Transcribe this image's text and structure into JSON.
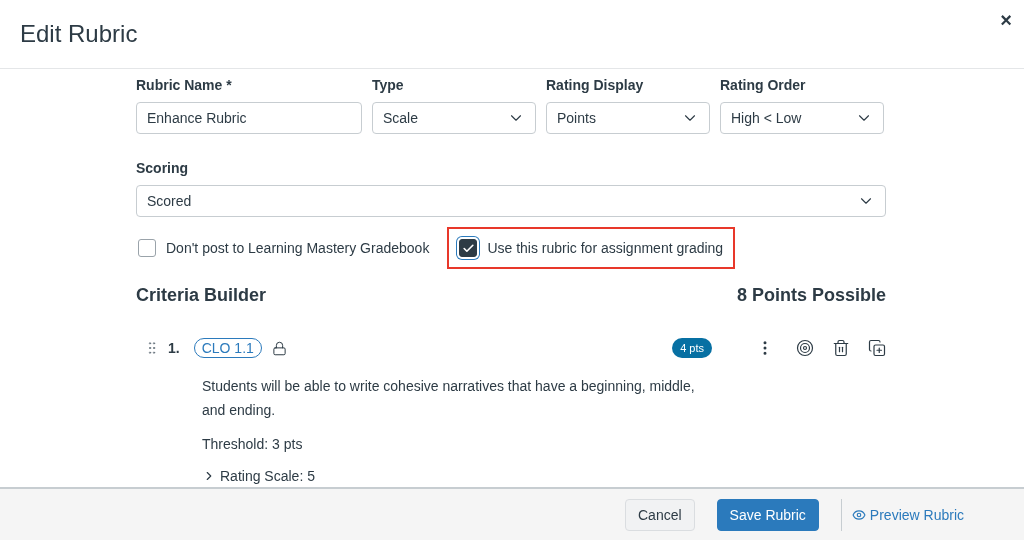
{
  "dialog": {
    "title": "Edit Rubric",
    "close": "×"
  },
  "fields": [
    {
      "kind": "text",
      "label": "Rubric Name *",
      "value": "Enhance Rubric"
    },
    {
      "kind": "select",
      "label": "Type",
      "value": "Scale"
    },
    {
      "kind": "select",
      "label": "Rating Display",
      "value": "Points"
    },
    {
      "kind": "select",
      "label": "Rating Order",
      "value": "High < Low"
    }
  ],
  "scoring": {
    "label": "Scoring",
    "value": "Scored"
  },
  "options": [
    {
      "label": "Don't post to Learning Mastery Gradebook",
      "checked": false,
      "highlighted": false
    },
    {
      "label": "Use this rubric for assignment grading",
      "checked": true,
      "highlighted": true
    }
  ],
  "criteria_builder": {
    "title": "Criteria Builder",
    "total": "8 Points Possible"
  },
  "criteria": [
    {
      "number": "1.",
      "tag": "CLO 1.1",
      "points": "4 pts",
      "description": "Students will be able to write cohesive narratives that have a beginning, middle, and ending.",
      "threshold": "Threshold: 3 pts",
      "rating_scale": "Rating Scale: 5",
      "expanded": false
    }
  ],
  "footer": {
    "cancel": "Cancel",
    "save": "Save Rubric",
    "preview": "Preview Rubric"
  }
}
